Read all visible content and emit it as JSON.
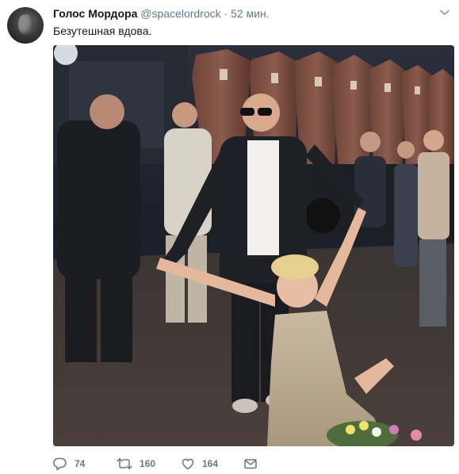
{
  "tweet": {
    "author_name": "Голос Мордора",
    "author_handle": "@spacelordrock",
    "separator": "·",
    "time": "52 мин.",
    "text": "Безутешная вдова."
  },
  "actions": {
    "reply_count": "74",
    "retweet_count": "160",
    "like_count": "164"
  },
  "icons": {
    "reply": "speech-bubble",
    "retweet": "two-arrows-loop",
    "like": "heart-outline",
    "message": "envelope",
    "more": "chevron-down"
  },
  "colors": {
    "icon_gray": "#657786",
    "text": "#14171a"
  }
}
